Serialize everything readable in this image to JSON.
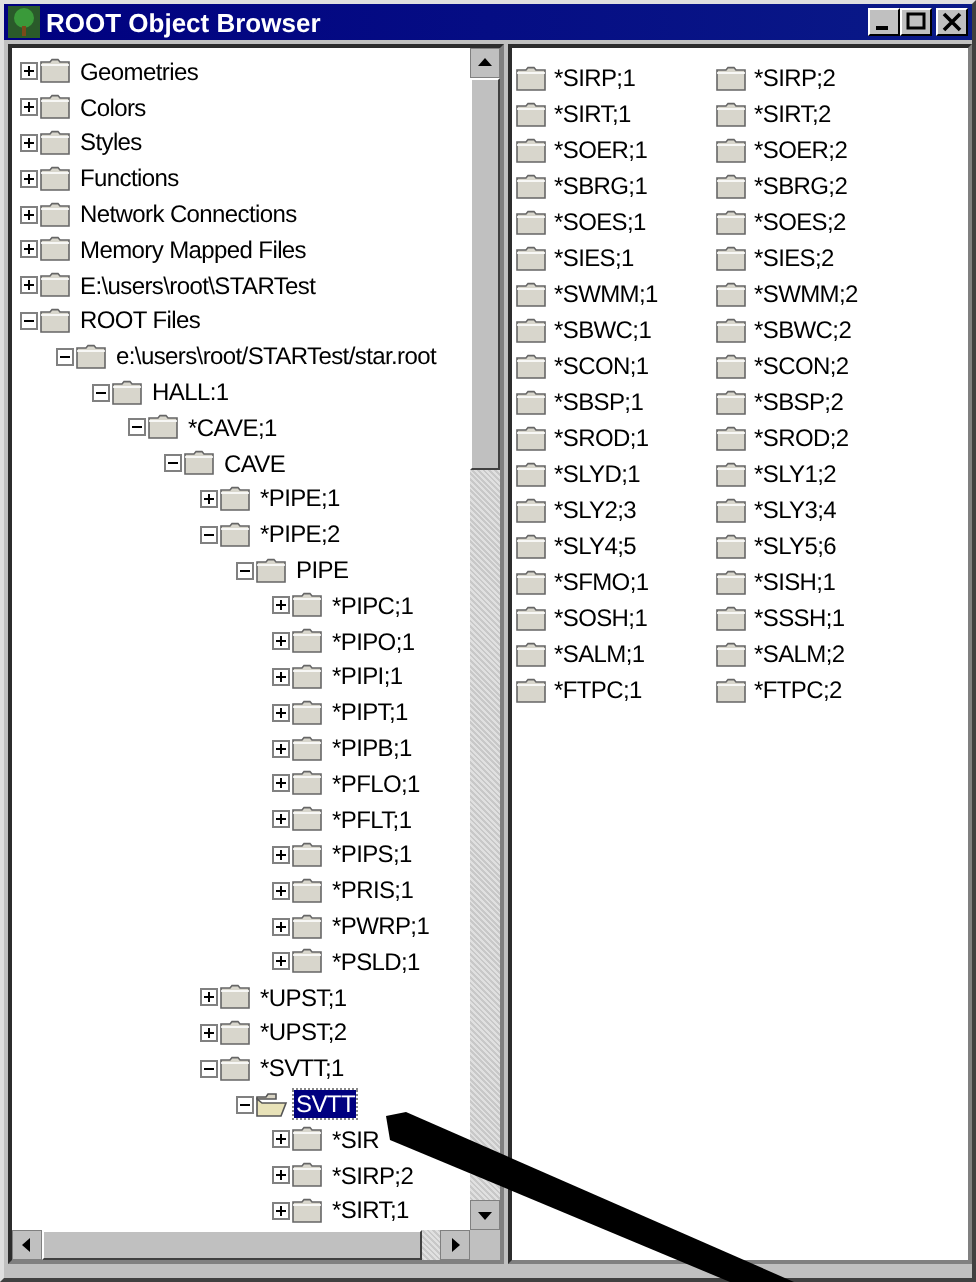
{
  "window": {
    "title": "ROOT Object Browser"
  },
  "tree": [
    {
      "label": "Geometries",
      "expanded": false,
      "selected": false
    },
    {
      "label": "Colors",
      "expanded": false,
      "selected": false
    },
    {
      "label": "Styles",
      "expanded": false,
      "selected": false
    },
    {
      "label": "Functions",
      "expanded": false,
      "selected": false
    },
    {
      "label": "Network Connections",
      "expanded": false,
      "selected": false
    },
    {
      "label": "Memory Mapped Files",
      "expanded": false,
      "selected": false
    },
    {
      "label": "E:\\users\\root\\STARTest",
      "expanded": false,
      "selected": false
    },
    {
      "label": "ROOT Files",
      "expanded": true,
      "selected": false,
      "children": [
        {
          "label": "e:\\users\\root/STARTest/star.root",
          "expanded": true,
          "selected": false,
          "children": [
            {
              "label": "HALL:1",
              "expanded": true,
              "selected": false,
              "children": [
                {
                  "label": "*CAVE;1",
                  "expanded": true,
                  "selected": false,
                  "children": [
                    {
                      "label": "CAVE",
                      "expanded": true,
                      "selected": false,
                      "children": [
                        {
                          "label": "*PIPE;1",
                          "expanded": false,
                          "selected": false
                        },
                        {
                          "label": "*PIPE;2",
                          "expanded": true,
                          "selected": false,
                          "children": [
                            {
                              "label": "PIPE",
                              "expanded": true,
                              "selected": false,
                              "children": [
                                {
                                  "label": "*PIPC;1",
                                  "expanded": false,
                                  "selected": false
                                },
                                {
                                  "label": "*PIPO;1",
                                  "expanded": false,
                                  "selected": false
                                },
                                {
                                  "label": "*PIPI;1",
                                  "expanded": false,
                                  "selected": false
                                },
                                {
                                  "label": "*PIPT;1",
                                  "expanded": false,
                                  "selected": false
                                },
                                {
                                  "label": "*PIPB;1",
                                  "expanded": false,
                                  "selected": false
                                },
                                {
                                  "label": "*PFLO;1",
                                  "expanded": false,
                                  "selected": false
                                },
                                {
                                  "label": "*PFLT;1",
                                  "expanded": false,
                                  "selected": false
                                },
                                {
                                  "label": "*PIPS;1",
                                  "expanded": false,
                                  "selected": false
                                },
                                {
                                  "label": "*PRIS;1",
                                  "expanded": false,
                                  "selected": false
                                },
                                {
                                  "label": "*PWRP;1",
                                  "expanded": false,
                                  "selected": false
                                },
                                {
                                  "label": "*PSLD;1",
                                  "expanded": false,
                                  "selected": false
                                }
                              ]
                            }
                          ]
                        },
                        {
                          "label": "*UPST;1",
                          "expanded": false,
                          "selected": false
                        },
                        {
                          "label": "*UPST;2",
                          "expanded": false,
                          "selected": false
                        },
                        {
                          "label": "*SVTT;1",
                          "expanded": true,
                          "selected": false,
                          "children": [
                            {
                              "label": "SVTT",
                              "expanded": true,
                              "selected": true,
                              "children": [
                                {
                                  "label": "*SIR",
                                  "expanded": false,
                                  "selected": false
                                },
                                {
                                  "label": "*SIRP;2",
                                  "expanded": false,
                                  "selected": false
                                },
                                {
                                  "label": "*SIRT;1",
                                  "expanded": false,
                                  "selected": false
                                }
                              ]
                            }
                          ]
                        }
                      ]
                    }
                  ]
                }
              ]
            }
          ]
        }
      ]
    }
  ],
  "list": [
    "*SIRP;1",
    "*SIRP;2",
    "*SIRT;1",
    "*SIRT;2",
    "*SOER;1",
    "*SOER;2",
    "*SBRG;1",
    "*SBRG;2",
    "*SOES;1",
    "*SOES;2",
    "*SIES;1",
    "*SIES;2",
    "*SWMM;1",
    "*SWMM;2",
    "*SBWC;1",
    "*SBWC;2",
    "*SCON;1",
    "*SCON;2",
    "*SBSP;1",
    "*SBSP;2",
    "*SROD;1",
    "*SROD;2",
    "*SLYD;1",
    "*SLY1;2",
    "*SLY2;3",
    "*SLY3;4",
    "*SLY4;5",
    "*SLY5;6",
    "*SFMO;1",
    "*SISH;1",
    "*SOSH;1",
    "*SSSH;1",
    "*SALM;1",
    "*SALM;2",
    "*FTPC;1",
    "*FTPC;2"
  ]
}
